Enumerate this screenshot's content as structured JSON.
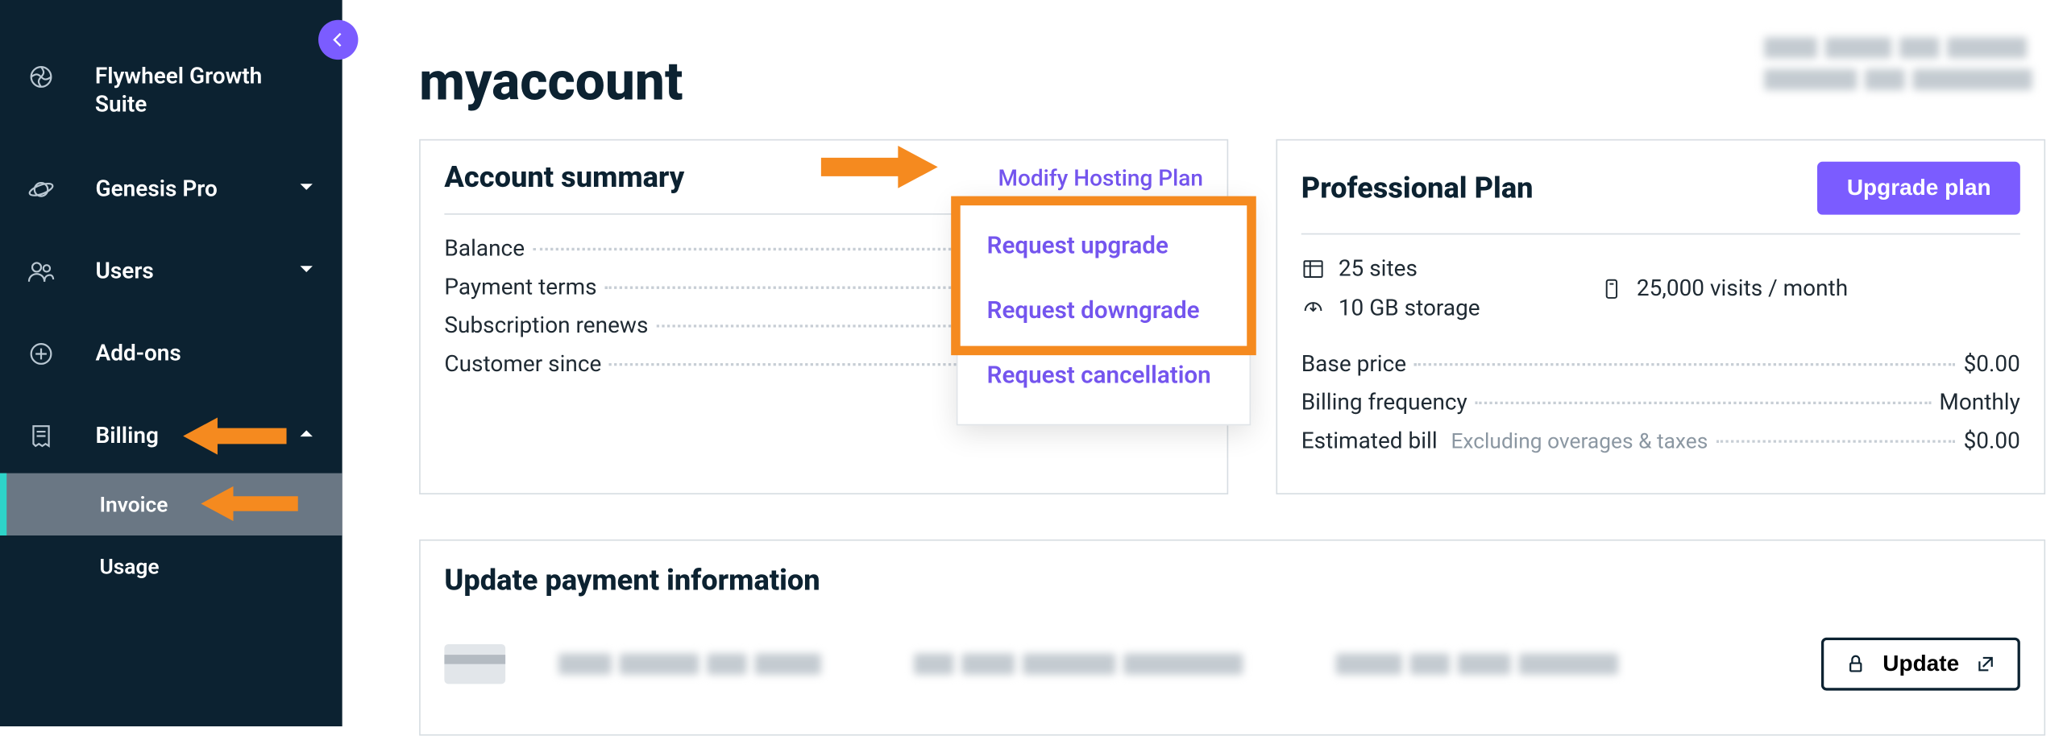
{
  "sidebar": {
    "items": [
      {
        "label": "Flywheel Growth Suite",
        "icon": "fan-icon",
        "chevron": false,
        "twoline": true
      },
      {
        "label": "Genesis Pro",
        "icon": "saturn-icon",
        "chevron": "down"
      },
      {
        "label": "Users",
        "icon": "users-icon",
        "chevron": "down"
      },
      {
        "label": "Add-ons",
        "icon": "plus-circle-icon",
        "chevron": false
      },
      {
        "label": "Billing",
        "icon": "receipt-icon",
        "chevron": "up"
      }
    ],
    "subitems": [
      {
        "label": "Invoice",
        "active": true
      },
      {
        "label": "Usage",
        "active": false
      }
    ]
  },
  "page": {
    "title": "myaccount"
  },
  "summary": {
    "heading": "Account summary",
    "modify_label": "Modify Hosting Plan",
    "rows": [
      {
        "label": "Balance",
        "value": ""
      },
      {
        "label": "Payment terms",
        "value": ""
      },
      {
        "label": "Subscription renews",
        "value": ""
      },
      {
        "label": "Customer since",
        "value": ""
      }
    ],
    "dropdown": [
      "Request upgrade",
      "Request downgrade",
      "Request cancellation"
    ]
  },
  "plan": {
    "heading": "Professional Plan",
    "upgrade_label": "Upgrade plan",
    "stats": {
      "sites": "25 sites",
      "visits": "25,000 visits / month",
      "storage": "10 GB storage"
    },
    "rows": [
      {
        "label": "Base price",
        "value": "$0.00"
      },
      {
        "label": "Billing frequency",
        "value": "Monthly"
      },
      {
        "label": "Estimated bill",
        "note": "Excluding overages & taxes",
        "value": "$0.00"
      }
    ]
  },
  "payment": {
    "heading": "Update payment information",
    "update_label": "Update"
  }
}
